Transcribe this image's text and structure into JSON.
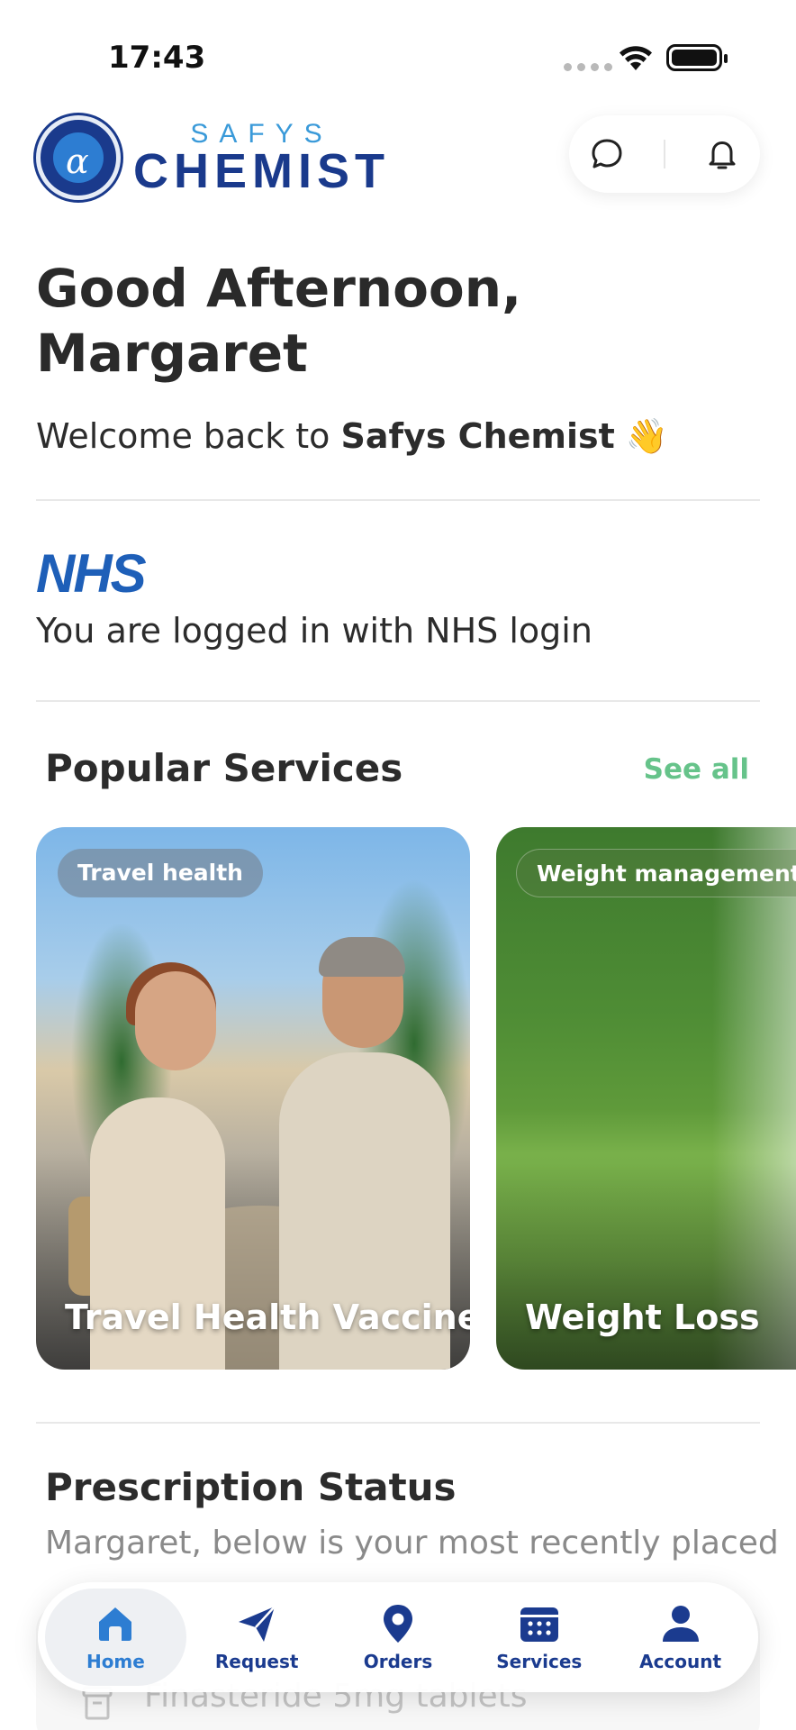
{
  "status_bar": {
    "time": "17:43"
  },
  "header": {
    "logo_top": "SAFYS",
    "logo_main": "CHEMIST",
    "logo_symbol": "α",
    "chat_icon": "chat-bubble-icon",
    "notification_icon": "bell-icon"
  },
  "greeting": {
    "title": "Good Afternoon, Margaret",
    "welcome_prefix": "Welcome back to ",
    "welcome_brand": "Safys Chemist",
    "welcome_emoji": "👋"
  },
  "nhs": {
    "logo_text": "NHS",
    "message": "You are logged in with NHS login"
  },
  "popular_services": {
    "title": "Popular Services",
    "see_all": "See all",
    "cards": [
      {
        "tag": "Travel health",
        "title": "Travel Health Vaccine"
      },
      {
        "tag": "Weight management",
        "title": "Weight Loss"
      }
    ]
  },
  "prescription_status": {
    "title": "Prescription Status",
    "subtitle": "Margaret, below is your most recently placed",
    "item_name": "Finasteride 5mg tablets"
  },
  "bottom_nav": {
    "items": [
      {
        "label": "Home",
        "icon": "home-icon",
        "active": true
      },
      {
        "label": "Request",
        "icon": "paper-plane-icon",
        "active": false
      },
      {
        "label": "Orders",
        "icon": "map-pin-icon",
        "active": false
      },
      {
        "label": "Services",
        "icon": "calendar-icon",
        "active": false
      },
      {
        "label": "Account",
        "icon": "user-icon",
        "active": false
      }
    ]
  },
  "colors": {
    "brand_navy": "#1b3b8f",
    "brand_blue": "#2d7dd2",
    "nhs_blue": "#1e5fb8",
    "accent_green": "#66c38a"
  }
}
